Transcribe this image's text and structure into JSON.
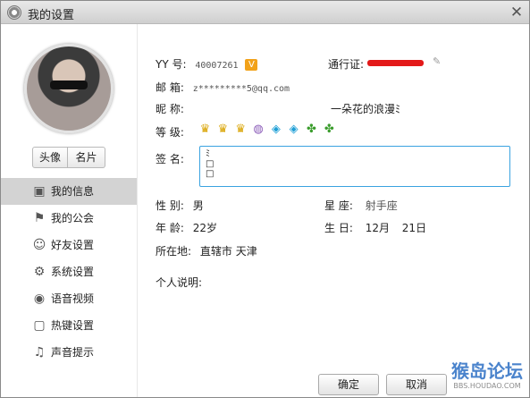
{
  "window": {
    "title": "我的设置",
    "close_glyph": "✕"
  },
  "sidebar": {
    "avatar_label": "avatar-photo",
    "seg_left": "头像",
    "seg_right": "名片",
    "items": [
      {
        "label": "我的信息",
        "icon": "id-card-icon",
        "glyph": "▣",
        "active": true
      },
      {
        "label": "我的公会",
        "icon": "flag-icon",
        "glyph": "⚑",
        "active": false
      },
      {
        "label": "好友设置",
        "icon": "friends-icon",
        "glyph": "☺",
        "active": false
      },
      {
        "label": "系统设置",
        "icon": "gear-icon",
        "glyph": "⚙",
        "active": false
      },
      {
        "label": "语音视频",
        "icon": "webcam-icon",
        "glyph": "◉",
        "active": false
      },
      {
        "label": "热键设置",
        "icon": "keyboard-icon",
        "glyph": "▢",
        "active": false
      },
      {
        "label": "声音提示",
        "icon": "music-note-icon",
        "glyph": "♫",
        "active": false
      }
    ]
  },
  "profile": {
    "yy_label": "YY 号:",
    "yy_value": "40007261",
    "vip_mark": "V",
    "passport_label": "通行证:",
    "email_label": "邮  箱:",
    "email_value": "z*********5@qq.com",
    "nickname_label": "昵  称:",
    "nickname_value": "一朵花的浪漫ﾐ",
    "level_label": "等  级:",
    "signature_label": "签  名:",
    "signature_lines": [
      "ﾐ",
      "□",
      "□"
    ],
    "gender_label": "性  别:",
    "gender_value": "男",
    "zodiac_label": "星  座:",
    "zodiac_value": "射手座",
    "age_label": "年  龄:",
    "age_value": "22岁",
    "birthday_label": "生  日:",
    "birthday_month": "12月",
    "birthday_day": "21日",
    "location_label": "所在地:",
    "location_value": "直辖市  天津",
    "intro_label": "个人说明:"
  },
  "level_badges": [
    {
      "icon": "crown-icon",
      "glyph": "♛",
      "kind": "crown"
    },
    {
      "icon": "crown-icon",
      "glyph": "♛",
      "kind": "crown"
    },
    {
      "icon": "crown-icon",
      "glyph": "♛",
      "kind": "crown"
    },
    {
      "icon": "shield-badge-icon",
      "glyph": "◍",
      "kind": "purple"
    },
    {
      "icon": "diamond-icon",
      "glyph": "◈",
      "kind": "diamond"
    },
    {
      "icon": "diamond-icon",
      "glyph": "◈",
      "kind": "diamond"
    },
    {
      "icon": "clover-icon",
      "glyph": "✤",
      "kind": "sun"
    },
    {
      "icon": "clover-icon",
      "glyph": "✤",
      "kind": "sun"
    }
  ],
  "buttons": {
    "ok": "确定",
    "cancel": "取消"
  },
  "watermark": {
    "title": "猴岛论坛",
    "url": "BBS.HOUDAO.COM"
  },
  "colors": {
    "redacted_bar": "#e31919",
    "focus_border": "#3aa3e0"
  }
}
